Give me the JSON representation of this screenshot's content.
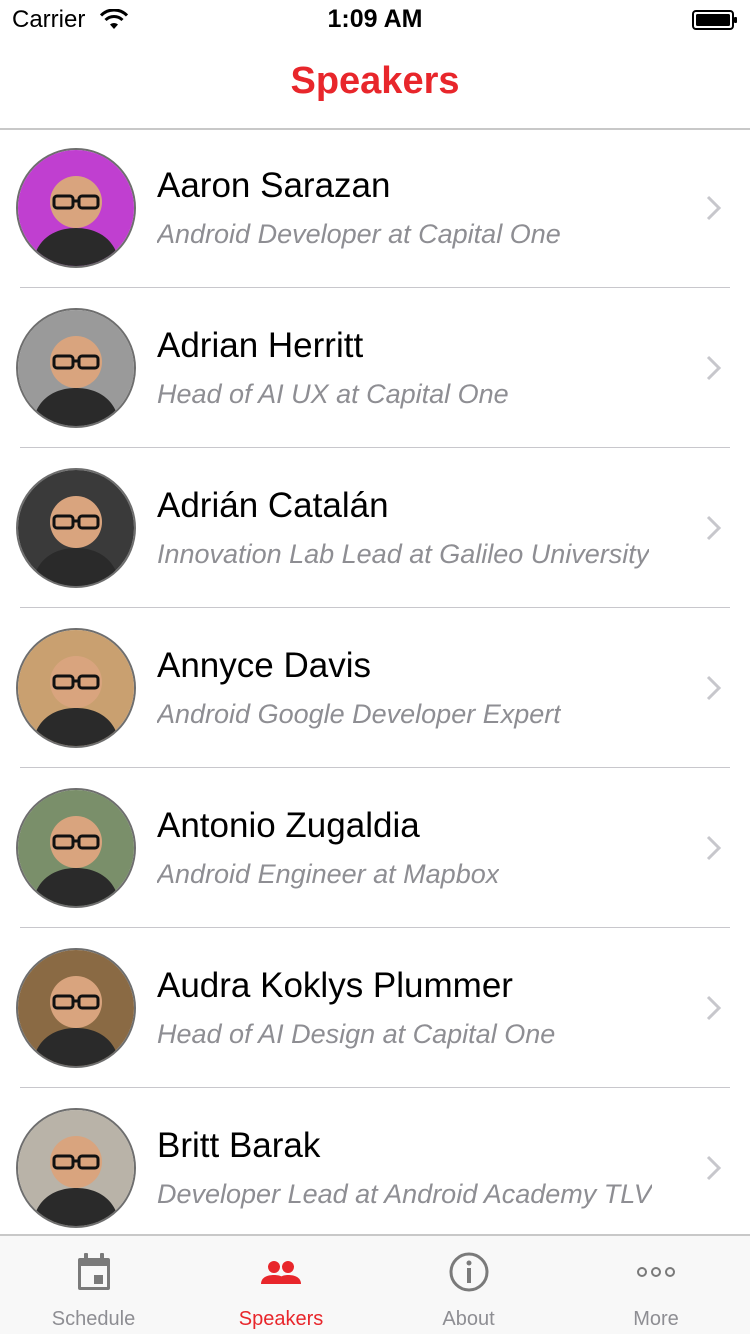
{
  "status_bar": {
    "carrier": "Carrier",
    "time": "1:09 AM"
  },
  "nav": {
    "title": "Speakers"
  },
  "colors": {
    "accent": "#e8262b",
    "subtitle": "#8e8e93",
    "separator": "#c8c7cc"
  },
  "speakers": [
    {
      "name": "Aaron Sarazan",
      "title": "Android Developer at Capital One",
      "avatar_bg": "#c03fd0"
    },
    {
      "name": "Adrian Herritt",
      "title": "Head of AI UX at Capital One",
      "avatar_bg": "#9a9a9a"
    },
    {
      "name": "Adrián Catalán",
      "title": "Innovation Lab Lead at Galileo University",
      "avatar_bg": "#3a3a3a"
    },
    {
      "name": "Annyce Davis",
      "title": "Android Google Developer Expert",
      "avatar_bg": "#c9a070"
    },
    {
      "name": "Antonio Zugaldia",
      "title": "Android Engineer at Mapbox",
      "avatar_bg": "#7a8f6a"
    },
    {
      "name": "Audra Koklys Plummer",
      "title": "Head of AI Design at Capital One",
      "avatar_bg": "#8a6a44"
    },
    {
      "name": "Britt Barak",
      "title": "Developer Lead at Android Academy TLV",
      "avatar_bg": "#b9b3a8"
    }
  ],
  "tabs": [
    {
      "label": "Schedule",
      "icon": "calendar-icon",
      "active": false
    },
    {
      "label": "Speakers",
      "icon": "people-icon",
      "active": true
    },
    {
      "label": "About",
      "icon": "info-icon",
      "active": false
    },
    {
      "label": "More",
      "icon": "more-icon",
      "active": false
    }
  ]
}
